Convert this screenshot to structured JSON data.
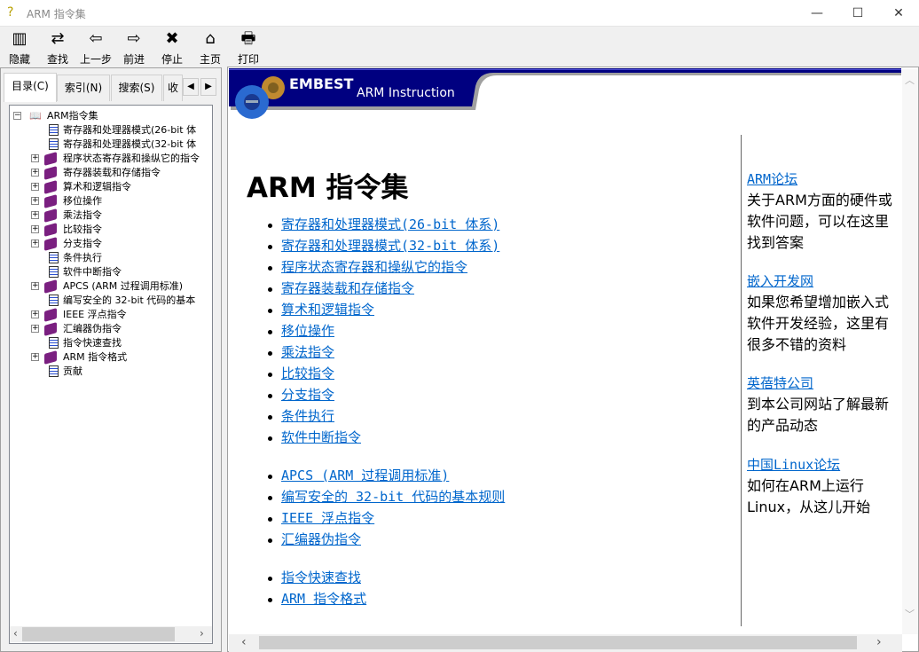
{
  "window": {
    "title": "ARM 指令集",
    "minimize": "—",
    "maximize": "☐",
    "close": "✕"
  },
  "toolbar": [
    {
      "label": "隐藏",
      "icon": "hide-icon",
      "glyph": "▥"
    },
    {
      "label": "查找",
      "icon": "find-icon",
      "glyph": "⇄"
    },
    {
      "label": "上一步",
      "icon": "back-arrow-icon",
      "glyph": "⇦"
    },
    {
      "label": "前进",
      "icon": "forward-arrow-icon",
      "glyph": "⇨"
    },
    {
      "label": "停止",
      "icon": "stop-icon",
      "glyph": "✖"
    },
    {
      "label": "主页",
      "icon": "home-icon",
      "glyph": "⌂"
    },
    {
      "label": "打印",
      "icon": "print-icon",
      "glyph": "🖶"
    }
  ],
  "tabs": [
    {
      "label": "目录(C)"
    },
    {
      "label": "索引(N)"
    },
    {
      "label": "搜索(S)"
    },
    {
      "label": "收"
    }
  ],
  "tree": {
    "root": "ARM指令集",
    "items": [
      {
        "label": "寄存器和处理器模式(26-bit 体",
        "type": "page"
      },
      {
        "label": "寄存器和处理器模式(32-bit 体",
        "type": "page"
      },
      {
        "label": "程序状态寄存器和操纵它的指令",
        "type": "book"
      },
      {
        "label": "寄存器装载和存储指令",
        "type": "book"
      },
      {
        "label": "算术和逻辑指令",
        "type": "book"
      },
      {
        "label": "移位操作",
        "type": "book"
      },
      {
        "label": "乘法指令",
        "type": "book"
      },
      {
        "label": "比较指令",
        "type": "book"
      },
      {
        "label": "分支指令",
        "type": "book"
      },
      {
        "label": "条件执行",
        "type": "page"
      },
      {
        "label": "软件中断指令",
        "type": "page"
      },
      {
        "label": "APCS (ARM 过程调用标准)",
        "type": "book"
      },
      {
        "label": "编写安全的 32-bit 代码的基本",
        "type": "page"
      },
      {
        "label": "IEEE 浮点指令",
        "type": "book"
      },
      {
        "label": "汇编器伪指令",
        "type": "book"
      },
      {
        "label": "指令快速查找",
        "type": "page"
      },
      {
        "label": "ARM 指令格式",
        "type": "book"
      },
      {
        "label": "贡献",
        "type": "page"
      }
    ]
  },
  "banner": {
    "brand": "EMBEST",
    "subtitle": "ARM Instruction",
    "color": "#000080"
  },
  "main": {
    "title": "ARM 指令集",
    "groups": [
      [
        "寄存器和处理器模式(26-bit 体系)",
        "寄存器和处理器模式(32-bit 体系)",
        "程序状态寄存器和操纵它的指令",
        "寄存器装载和存储指令",
        "算术和逻辑指令",
        "移位操作",
        "乘法指令",
        "比较指令",
        "分支指令",
        "条件执行",
        "软件中断指令"
      ],
      [
        "APCS (ARM 过程调用标准)",
        "编写安全的 32-bit 代码的基本规则",
        "IEEE 浮点指令",
        "汇编器伪指令"
      ],
      [
        "指令快速查找",
        "ARM 指令格式"
      ]
    ]
  },
  "sidebar": [
    {
      "link": "ARM论坛",
      "text": "关于ARM方面的硬件或软件问题，可以在这里找到答案"
    },
    {
      "link": "嵌入开发网",
      "text": "如果您希望增加嵌入式软件开发经验，这里有很多不错的资料"
    },
    {
      "link": "英蓓特公司",
      "text": "到本公司网站了解最新的产品动态"
    },
    {
      "link": "中国Linux论坛",
      "text": "如何在ARM上运行Linux，从这儿开始"
    }
  ],
  "link_color": "#0066cc"
}
